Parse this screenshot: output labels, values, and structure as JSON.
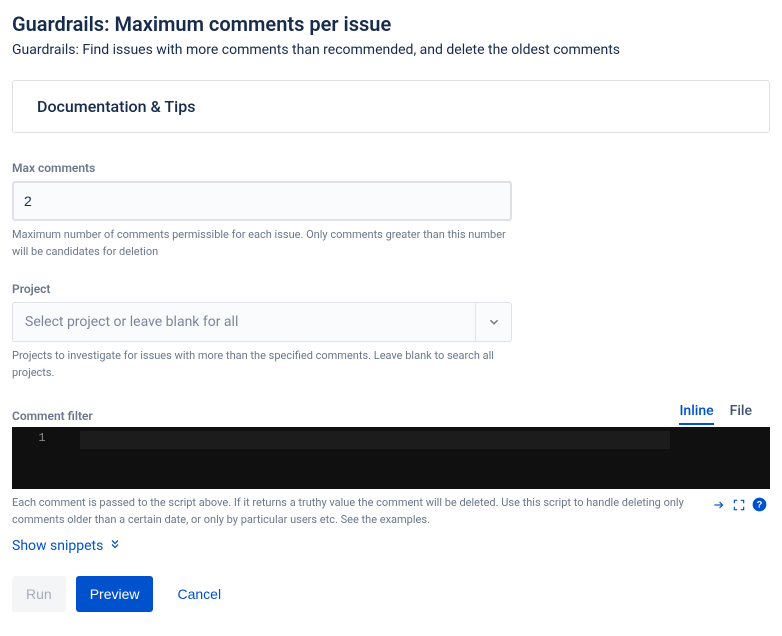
{
  "header": {
    "title": "Guardrails: Maximum comments per issue",
    "subtitle": "Guardrails: Find issues with more comments than recommended, and delete the oldest comments"
  },
  "panel": {
    "doc_tips": "Documentation & Tips"
  },
  "fields": {
    "max_comments": {
      "label": "Max comments",
      "value": "2",
      "help": "Maximum number of comments permissible for each issue. Only comments greater than this number will be candidates for deletion"
    },
    "project": {
      "label": "Project",
      "placeholder": "Select project or leave blank for all",
      "help": "Projects to investigate for issues with more than the specified comments. Leave blank to search all projects."
    },
    "comment_filter": {
      "label": "Comment filter",
      "tabs": {
        "inline": "Inline",
        "file": "File"
      },
      "line_number": "1",
      "help": "Each comment is passed to the script above. If it returns a truthy value the comment will be deleted. Use this script to handle deleting only comments older than a certain date, or only by particular users etc. See the examples.",
      "snippets": "Show snippets"
    }
  },
  "buttons": {
    "run": "Run",
    "preview": "Preview",
    "cancel": "Cancel"
  }
}
